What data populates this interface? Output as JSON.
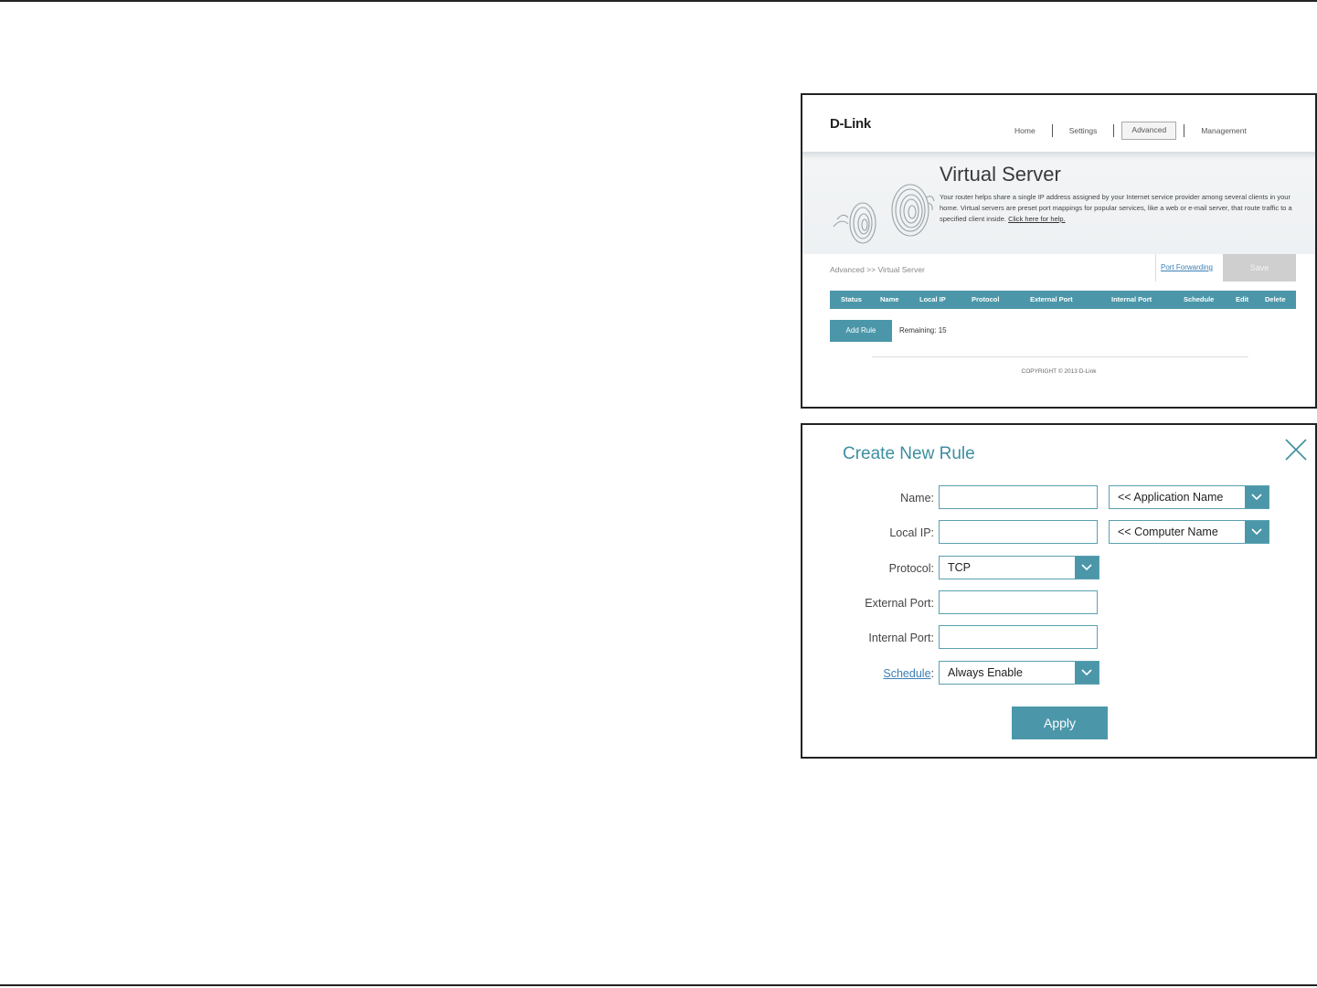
{
  "virtual_server": {
    "logo": "D-Link",
    "nav": [
      "Home",
      "Settings",
      "Advanced",
      "Management"
    ],
    "active_nav": "Advanced",
    "title": "Virtual Server",
    "description": "Your router helps share a single IP address assigned by your Internet service provider among several clients in your home. Virtual servers are preset port mappings for popular services, like a web or e-mail server, that route traffic to a specified client inside.",
    "help_link": "Click here for help.",
    "breadcrumb": "Advanced >> Virtual Server",
    "port_forwarding_link": "Port Forwarding",
    "save_label": "Save",
    "columns": [
      "Status",
      "Name",
      "Local IP",
      "Protocol",
      "External Port",
      "Internal Port",
      "Schedule",
      "Edit",
      "Delete"
    ],
    "add_rule_label": "Add Rule",
    "remaining": "Remaining: 15",
    "copyright": "COPYRIGHT © 2013 D-Link"
  },
  "create_rule": {
    "title": "Create New Rule",
    "name_label": "Name:",
    "application_select": "<< Application Name",
    "local_ip_label": "Local IP:",
    "computer_select": "<< Computer Name",
    "protocol_label": "Protocol:",
    "protocol_value": "TCP",
    "external_port_label": "External Port:",
    "internal_port_label": "Internal Port:",
    "schedule_link": "Schedule",
    "schedule_colon": ":",
    "schedule_value": "Always Enable",
    "apply_label": "Apply",
    "name_value": "",
    "local_ip_value": "",
    "external_port_value": "",
    "internal_port_value": ""
  },
  "colors": {
    "accent": "#4b97a9",
    "title_teal": "#3e8ea0",
    "link_blue": "#3c7fb5"
  },
  "icons": [
    "close-icon",
    "chevron-down-icon",
    "swirl-graphic"
  ]
}
